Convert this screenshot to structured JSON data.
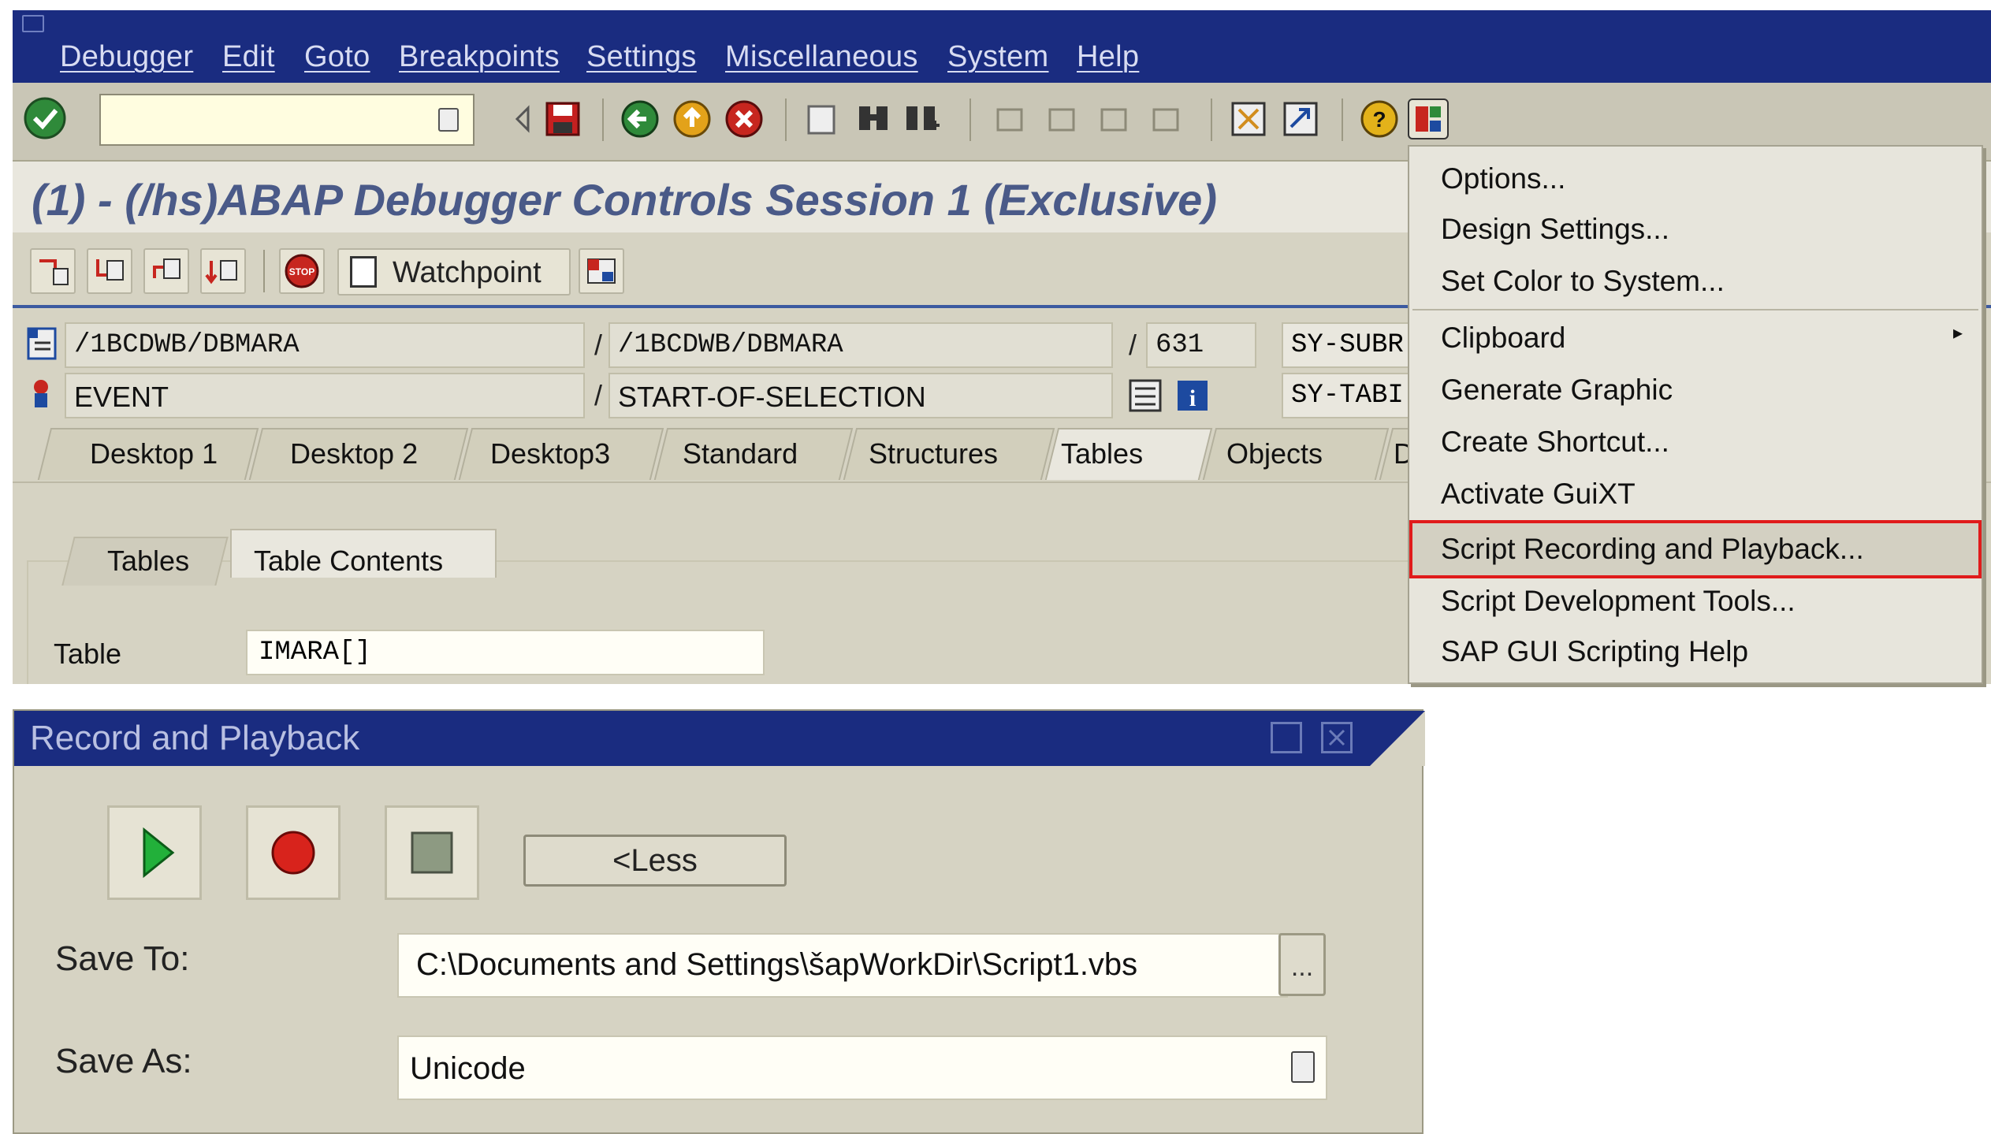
{
  "menubar": {
    "items": [
      "Debugger",
      "Edit",
      "Goto",
      "Breakpoints",
      "Settings",
      "Miscellaneous",
      "System",
      "Help"
    ]
  },
  "toolbar": {
    "command_field_value": ""
  },
  "title": "(1) - (/hs)ABAP Debugger Controls Session 1 (Exclusive)",
  "app_toolbar": {
    "watchpoint_label": "Watchpoint"
  },
  "source_info": {
    "program": "/1BCDWB/DBMARA",
    "include": "/1BCDWB/DBMARA",
    "line": "631",
    "event_type": "EVENT",
    "event_name": "START-OF-SELECTION",
    "sy_subrc_label": "SY-SUBR",
    "sy_tabix_label": "SY-TABI"
  },
  "desktop_tabs": [
    "Desktop 1",
    "Desktop 2",
    "Desktop3",
    "Standard",
    "Structures",
    "Tables",
    "Objects",
    "D"
  ],
  "active_tab": "Tables",
  "sub_tabs": [
    "Tables",
    "Table Contents"
  ],
  "table_label": "Table",
  "table_value": "IMARA[]",
  "context_menu": {
    "items": [
      "Options...",
      "Design Settings...",
      "Set Color to System...",
      "Clipboard",
      "Generate Graphic",
      "Create Shortcut...",
      "Activate GuiXT",
      "Script Recording and Playback...",
      "Script Development Tools...",
      "SAP GUI Scripting Help"
    ],
    "highlighted": "Script Recording and Playback...",
    "submenu_arrow": "▸"
  },
  "record_playback": {
    "title": "Record and Playback",
    "less_button": "<Less",
    "save_to_label": "Save To:",
    "save_to_value": "C:\\Documents and Settings\\šapWorkDir\\Script1.vbs",
    "browse_label": "...",
    "save_as_label": "Save As:",
    "save_as_value": "Unicode"
  },
  "colors": {
    "menubar": "#1a2c80",
    "title_text": "#4a5a88",
    "highlight_border": "#e01b1b",
    "panel": "#d6d3c3"
  }
}
